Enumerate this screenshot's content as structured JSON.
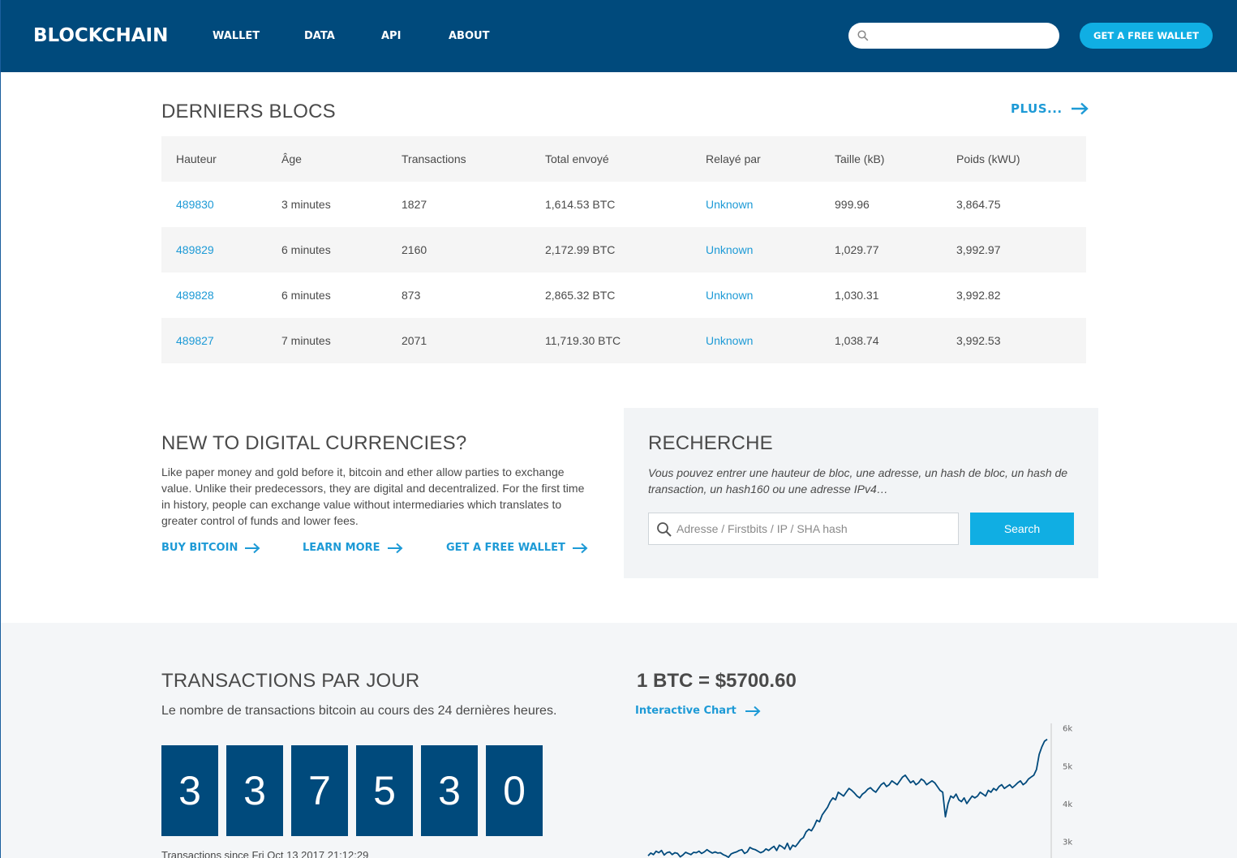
{
  "header": {
    "logo": "BLOCKCHAIN",
    "nav": [
      {
        "label": "WALLET"
      },
      {
        "label": "DATA"
      },
      {
        "label": "API"
      },
      {
        "label": "ABOUT"
      }
    ],
    "search_value": "",
    "cta_label": "GET A FREE WALLET",
    "colors": {
      "bar": "#004a7c",
      "accent": "#10aee3"
    }
  },
  "blocks": {
    "title": "DERNIERS BLOCS",
    "more_label": "PLUS...",
    "columns": [
      "Hauteur",
      "Âge",
      "Transactions",
      "Total envoyé",
      "Relayé par",
      "Taille (kB)",
      "Poids (kWU)"
    ],
    "rows": [
      [
        "489830",
        "3 minutes",
        "1827",
        "1,614.53 BTC",
        "Unknown",
        "999.96",
        "3,864.75"
      ],
      [
        "489829",
        "6 minutes",
        "2160",
        "2,172.99 BTC",
        "Unknown",
        "1,029.77",
        "3,992.97"
      ],
      [
        "489828",
        "6 minutes",
        "873",
        "2,865.32 BTC",
        "Unknown",
        "1,030.31",
        "3,992.82"
      ],
      [
        "489827",
        "7 minutes",
        "2071",
        "11,719.30 BTC",
        "Unknown",
        "1,038.74",
        "3,992.53"
      ]
    ]
  },
  "intro": {
    "title": "NEW TO DIGITAL CURRENCIES?",
    "body": "Like paper money and gold before it, bitcoin and ether allow parties to exchange value. Unlike their predecessors, they are digital and decentralized. For the first time in history, people can exchange value without intermediaries which translates to greater control of funds and lower fees.",
    "links": [
      "BUY BITCOIN",
      "LEARN MORE",
      "GET A FREE WALLET"
    ]
  },
  "search": {
    "title": "RECHERCHE",
    "description": "Vous pouvez entrer une hauteur de bloc, une adresse, un hash de bloc, un hash de transaction, un hash160 ou une adresse IPv4…",
    "placeholder": "Adresse / Firstbits / IP / SHA hash",
    "button_label": "Search"
  },
  "transactions": {
    "title": "TRANSACTIONS PAR JOUR",
    "subtitle": "Le nombre de transactions bitcoin au cours des 24 dernières heures.",
    "digits": [
      "3",
      "3",
      "7",
      "5",
      "3",
      "0"
    ],
    "since": "Transactions since Fri Oct 13 2017 21:12:29"
  },
  "price": {
    "headline": "1 BTC = $5700.60",
    "chart_link": "Interactive Chart"
  },
  "chart_data": {
    "type": "line",
    "color": "#004a7c",
    "y_ticks": [
      "6k",
      "5k",
      "4k",
      "3k"
    ],
    "y_tick_values": [
      6000,
      5000,
      4000,
      3000
    ],
    "ylim": [
      2560,
      6250
    ],
    "values": [
      2620,
      2690,
      2650,
      2740,
      2700,
      2760,
      2640,
      2700,
      2720,
      2650,
      2700,
      2680,
      2590,
      2640,
      2710,
      2680,
      2650,
      2710,
      2700,
      2740,
      2680,
      2720,
      2780,
      2730,
      2690,
      2720,
      2690,
      2700,
      2650,
      2620,
      2580,
      2670,
      2700,
      2720,
      2760,
      2780,
      2680,
      2720,
      2840,
      2800,
      2780,
      2740,
      2700,
      2730,
      2800,
      2760,
      2820,
      2870,
      2760,
      2900,
      2860,
      2800,
      2950,
      2780,
      2900,
      2860,
      2950,
      3050,
      3100,
      3250,
      3320,
      3280,
      3400,
      3560,
      3520,
      3700,
      3800,
      3900,
      4050,
      4150,
      4100,
      4300,
      4250,
      4200,
      4300,
      4400,
      4350,
      4280,
      4200,
      4150,
      4250,
      4300,
      4380,
      4420,
      4350,
      4300,
      4400,
      4500,
      4550,
      4450,
      4500,
      4600,
      4550,
      4500,
      4600,
      4700,
      4750,
      4650,
      4550,
      4600,
      4500,
      4550,
      4650,
      4600,
      4500,
      4550,
      4600,
      4550,
      4450,
      4350,
      4300,
      3650,
      4000,
      4200,
      4150,
      4250,
      4100,
      4050,
      4150,
      4000,
      4100,
      4200,
      4150,
      4200,
      4300,
      4250,
      4200,
      4350,
      4300,
      4400,
      4350,
      4450,
      4500,
      4400,
      4450,
      4500,
      4420,
      4480,
      4550,
      4600,
      4500,
      4550,
      4650,
      4700,
      4750,
      4900,
      5300,
      5500,
      5650,
      5700
    ]
  }
}
